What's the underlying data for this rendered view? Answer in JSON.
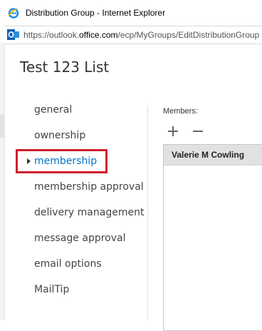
{
  "window": {
    "title": "Distribution Group - Internet Explorer"
  },
  "address_bar": {
    "url_prefix": "https://outlook.",
    "url_host": "office.com",
    "url_suffix": "/ecp/MyGroups/EditDistributionGroup"
  },
  "page": {
    "title": "Test 123 List"
  },
  "nav": {
    "items": [
      {
        "label": "general",
        "active": false
      },
      {
        "label": "ownership",
        "active": false
      },
      {
        "label": "membership",
        "active": true
      },
      {
        "label": "membership approval",
        "active": false
      },
      {
        "label": "delivery management",
        "active": false
      },
      {
        "label": "message approval",
        "active": false
      },
      {
        "label": "email options",
        "active": false
      },
      {
        "label": "MailTip",
        "active": false
      }
    ]
  },
  "members": {
    "label": "Members:",
    "add_icon": "plus-icon",
    "remove_icon": "minus-icon",
    "list": [
      "Valerie M Cowling"
    ]
  },
  "colors": {
    "active_link": "#0072c6",
    "highlight_border": "#d0202d",
    "selected_row": "#e1e1e1"
  }
}
